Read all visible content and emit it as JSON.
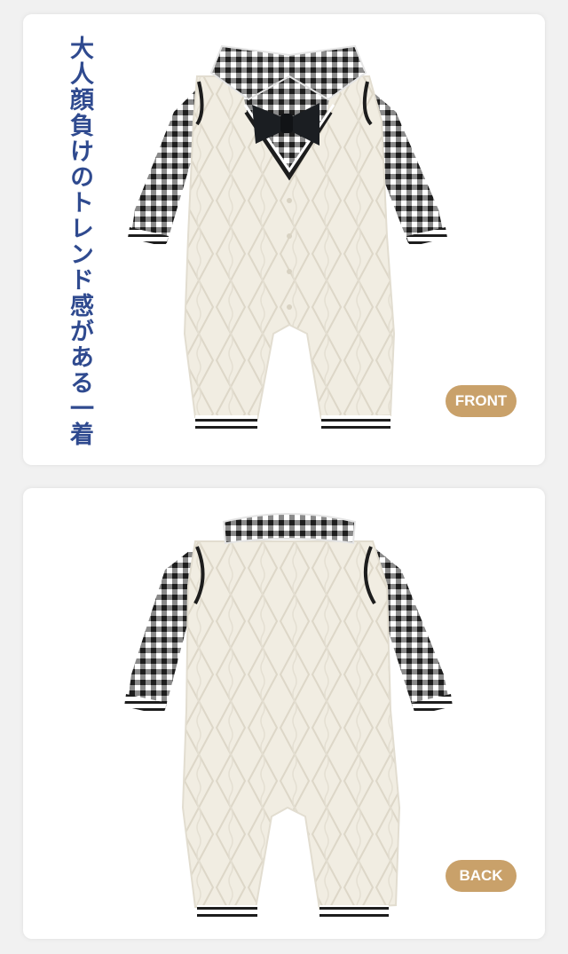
{
  "front": {
    "tagline": "大人顔負けのトレンド感がある一着",
    "badge": "FRONT"
  },
  "back": {
    "badge": "BACK"
  },
  "colors": {
    "tagline": "#2f4a8f",
    "badge": "#c9a16a",
    "knit": "#f1ede2",
    "check_dark": "#1d1d1d"
  }
}
